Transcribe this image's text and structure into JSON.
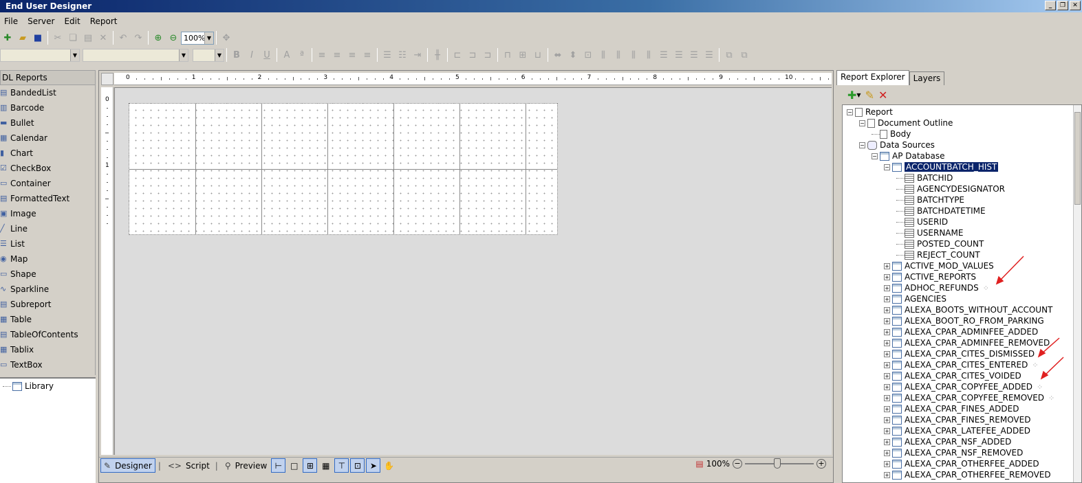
{
  "window": {
    "title": "End User Designer"
  },
  "menu": [
    "File",
    "Server",
    "Edit",
    "Report"
  ],
  "toolbar": {
    "zoom": "100%"
  },
  "toolbox": {
    "header": "DL Reports",
    "items": [
      {
        "label": "BandedList",
        "icon": "banded-list-icon"
      },
      {
        "label": "Barcode",
        "icon": "barcode-icon"
      },
      {
        "label": "Bullet",
        "icon": "bullet-icon"
      },
      {
        "label": "Calendar",
        "icon": "calendar-icon"
      },
      {
        "label": "Chart",
        "icon": "chart-icon"
      },
      {
        "label": "CheckBox",
        "icon": "checkbox-icon"
      },
      {
        "label": "Container",
        "icon": "container-icon"
      },
      {
        "label": "FormattedText",
        "icon": "formatted-text-icon"
      },
      {
        "label": "Image",
        "icon": "image-icon"
      },
      {
        "label": "Line",
        "icon": "line-icon"
      },
      {
        "label": "List",
        "icon": "list-icon"
      },
      {
        "label": "Map",
        "icon": "map-icon"
      },
      {
        "label": "Shape",
        "icon": "shape-icon"
      },
      {
        "label": "Sparkline",
        "icon": "sparkline-icon"
      },
      {
        "label": "Subreport",
        "icon": "subreport-icon"
      },
      {
        "label": "Table",
        "icon": "table-icon"
      },
      {
        "label": "TableOfContents",
        "icon": "toc-icon"
      },
      {
        "label": "Tablix",
        "icon": "tablix-icon"
      },
      {
        "label": "TextBox",
        "icon": "textbox-icon"
      }
    ],
    "library_label": "Library"
  },
  "ruler": {
    "h_labels": [
      "0",
      "1",
      "2",
      "3",
      "4",
      "5",
      "6",
      "7",
      "8",
      "9",
      "10"
    ],
    "v_labels": [
      "0",
      "1"
    ]
  },
  "bottombar": {
    "designer": "Designer",
    "script": "Script",
    "preview": "Preview",
    "zoom": "100%"
  },
  "explorer": {
    "tabs": [
      "Report Explorer",
      "Layers"
    ],
    "tree": {
      "report": "Report",
      "doc_outline": "Document Outline",
      "body": "Body",
      "data_sources": "Data Sources",
      "ap_database": "AP Database",
      "selected_table": "ACCOUNTBATCH_HIST",
      "fields": [
        "BATCHID",
        "AGENCYDESIGNATOR",
        "BATCHTYPE",
        "BATCHDATETIME",
        "USERID",
        "USERNAME",
        "POSTED_COUNT",
        "REJECT_COUNT"
      ],
      "tables": [
        "ACTIVE_MOD_VALUES",
        "ACTIVE_REPORTS",
        "ADHOC_REFUNDS",
        "AGENCIES",
        "ALEXA_BOOTS_WITHOUT_ACCOUNT",
        "ALEXA_BOOT_RO_FROM_PARKING",
        "ALEXA_CPAR_ADMINFEE_ADDED",
        "ALEXA_CPAR_ADMINFEE_REMOVED",
        "ALEXA_CPAR_CITES_DISMISSED",
        "ALEXA_CPAR_CITES_ENTERED",
        "ALEXA_CPAR_CITES_VOIDED",
        "ALEXA_CPAR_COPYFEE_ADDED",
        "ALEXA_CPAR_COPYFEE_REMOVED",
        "ALEXA_CPAR_FINES_ADDED",
        "ALEXA_CPAR_FINES_REMOVED",
        "ALEXA_CPAR_LATEFEE_ADDED",
        "ALEXA_CPAR_NSF_ADDED",
        "ALEXA_CPAR_NSF_REMOVED",
        "ALEXA_CPAR_OTHERFEE_ADDED",
        "ALEXA_CPAR_OTHERFEE_REMOVED"
      ],
      "loading_rows": [
        2,
        9,
        11,
        12
      ]
    }
  },
  "colors": {
    "selection": "#0a246a",
    "arrow": "#e02020",
    "titlebar": "#0a246a"
  }
}
